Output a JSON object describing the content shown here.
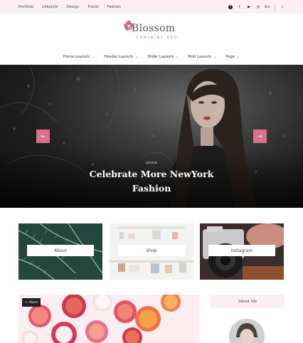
{
  "top_nav": [
    "Portfolio",
    "Lifestyle",
    "Design",
    "Travel",
    "Fashion"
  ],
  "social_icons": [
    "facebook-icon",
    "twitter-icon",
    "youtube-icon",
    "instagram-icon",
    "google-plus-icon",
    "search-icon"
  ],
  "social_glyphs": {
    "facebook": "f",
    "twitter": "t",
    "youtube": "▶",
    "instagram": "◎",
    "google_plus": "G+",
    "search": "⌕"
  },
  "brand": {
    "title": "Blossom",
    "subtitle": "FEMININE PRO",
    "accent": "#d8708e"
  },
  "main_nav": [
    {
      "label": "Home Layouts"
    },
    {
      "label": "Header Layouts"
    },
    {
      "label": "Slider Layouts"
    },
    {
      "label": "Post Layouts"
    },
    {
      "label": "Page"
    }
  ],
  "chevron": "⌄",
  "hero": {
    "category": "Lifestyle",
    "title": "Celebrate More NewYork Fashion",
    "prev": "←",
    "next": "→"
  },
  "tiles": [
    {
      "label": "About"
    },
    {
      "label": "Shop"
    },
    {
      "label": "Instagram"
    }
  ],
  "feature": {
    "share_label": "Share",
    "share_glyph": "<"
  },
  "sidebar": {
    "about_title": "About Me"
  }
}
